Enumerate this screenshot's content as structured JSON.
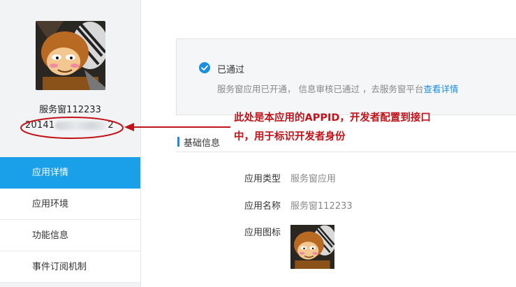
{
  "sidebar": {
    "app_name": "服务窗112233",
    "app_id_visible_prefix": "20141",
    "app_id_visible_suffix": "2",
    "nav": [
      {
        "label": "应用详情",
        "active": true
      },
      {
        "label": "应用环境",
        "active": false
      },
      {
        "label": "功能信息",
        "active": false
      },
      {
        "label": "事件订阅机制",
        "active": false
      }
    ]
  },
  "status": {
    "title": "已通过",
    "description": "服务窗应用已开通， 信息审核已通过 ，去服务窗平台",
    "link": "查看详情"
  },
  "annotation": {
    "line1": "此处是本应用的APPID，开发者配置到接口",
    "line2": "中，用于标识开发者身份",
    "color": "#c0131a"
  },
  "basic_info": {
    "section_title": "基础信息",
    "type_label": "应用类型",
    "type_value": "服务窗应用",
    "name_label": "应用名称",
    "name_value": "服务窗112233",
    "icon_label": "应用图标"
  },
  "colors": {
    "accent": "#1aa0e8",
    "link": "#1a8fe0",
    "annotation": "#c0131a"
  }
}
